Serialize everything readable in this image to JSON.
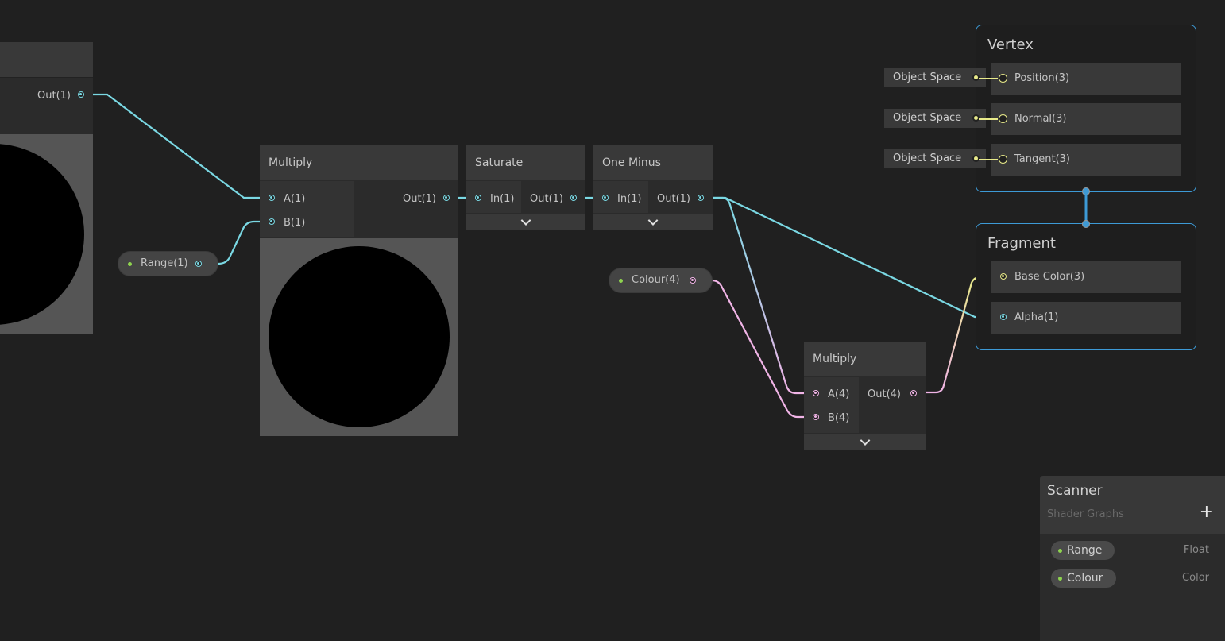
{
  "colors": {
    "float_wire": "#7ad8e3",
    "vector4_wire": "#f0b4e6",
    "vector3_wire": "#e8ea8a",
    "context_border": "#3d9ad6",
    "property_dot": "#8ed34f"
  },
  "nodes": {
    "offscreen_node": {
      "output_label": "Out(1)"
    },
    "multiply_1": {
      "title": "Multiply",
      "inputs": [
        "A(1)",
        "B(1)"
      ],
      "output": "Out(1)"
    },
    "saturate": {
      "title": "Saturate",
      "input": "In(1)",
      "output": "Out(1)"
    },
    "one_minus": {
      "title": "One Minus",
      "input": "In(1)",
      "output": "Out(1)"
    },
    "multiply_2": {
      "title": "Multiply",
      "inputs": [
        "A(4)",
        "B(4)"
      ],
      "output": "Out(4)"
    }
  },
  "property_nodes": {
    "range": {
      "label": "Range(1)"
    },
    "colour": {
      "label": "Colour(4)"
    }
  },
  "master_stack": {
    "vertex": {
      "title": "Vertex",
      "blocks": [
        {
          "label": "Position(3)",
          "default": "Object Space"
        },
        {
          "label": "Normal(3)",
          "default": "Object Space"
        },
        {
          "label": "Tangent(3)",
          "default": "Object Space"
        }
      ]
    },
    "fragment": {
      "title": "Fragment",
      "blocks": [
        {
          "label": "Base Color(3)"
        },
        {
          "label": "Alpha(1)"
        }
      ]
    }
  },
  "blackboard": {
    "title": "Scanner",
    "subtitle": "Shader Graphs",
    "add_icon": "+",
    "properties": [
      {
        "name": "Range",
        "type": "Float"
      },
      {
        "name": "Colour",
        "type": "Color"
      }
    ]
  }
}
